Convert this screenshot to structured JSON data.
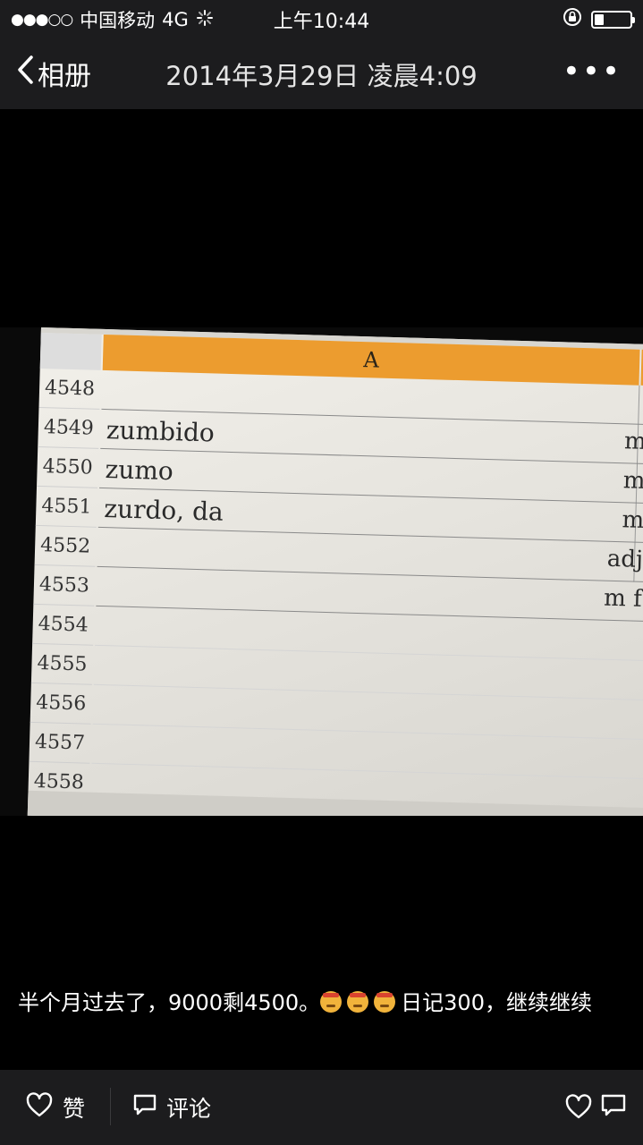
{
  "status_bar": {
    "signal": "●●●○○",
    "carrier": "中国移动",
    "network": "4G",
    "time": "上午10:44",
    "battery_level": 0.25
  },
  "nav": {
    "back_label": "相册",
    "title": "2014年3月29日 凌晨4:09",
    "more_label": "•••"
  },
  "spreadsheet": {
    "column_header": "A",
    "rows": [
      {
        "num": "4548",
        "word": "",
        "pos": ""
      },
      {
        "num": "4549",
        "word": "zumbido",
        "pos": "m"
      },
      {
        "num": "4550",
        "word": "zumo",
        "pos": "m"
      },
      {
        "num": "4551",
        "word": "zurdo, da",
        "pos": "m"
      },
      {
        "num": "4552",
        "word": "",
        "pos": "adj"
      },
      {
        "num": "4553",
        "word": "",
        "pos": "m f"
      },
      {
        "num": "4554",
        "word": "",
        "pos": ""
      },
      {
        "num": "4555",
        "word": "",
        "pos": ""
      },
      {
        "num": "4556",
        "word": "",
        "pos": ""
      },
      {
        "num": "4557",
        "word": "",
        "pos": ""
      },
      {
        "num": "4558",
        "word": "",
        "pos": ""
      }
    ]
  },
  "caption": {
    "text_before": "半个月过去了，9000剩4500。",
    "text_after": "日记300，继续继续"
  },
  "toolbar": {
    "like_label": "赞",
    "comment_label": "评论"
  },
  "icons": {
    "back": "chevron-left-icon",
    "more": "more-icon",
    "like": "heart-icon",
    "comment": "comment-icon",
    "lock": "rotation-lock-icon",
    "battery": "battery-icon",
    "loading": "activity-spinner-icon"
  },
  "colors": {
    "bar_background": "#1c1c1e",
    "spreadsheet_header": "#ec9c2f"
  }
}
